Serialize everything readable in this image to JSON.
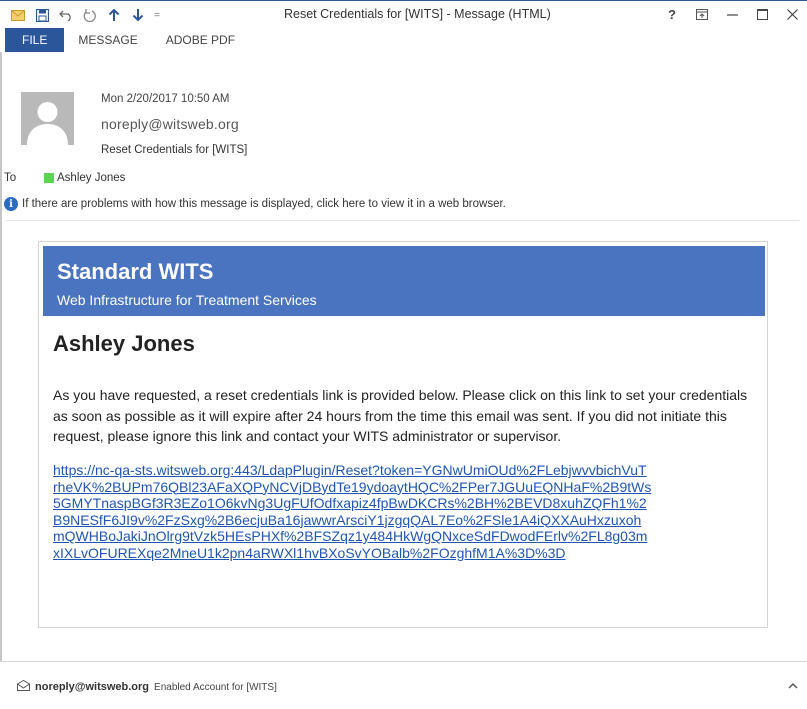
{
  "window": {
    "title": "Reset Credentials for [WITS] - Message (HTML)",
    "help_label": "?",
    "accent": "#2b579a"
  },
  "quick_access": {
    "icons": [
      "mail-icon",
      "save-icon",
      "undo-icon",
      "redo-icon",
      "previous-item-icon",
      "next-item-icon",
      "customize-icon"
    ],
    "sep_label": "="
  },
  "ribbon": {
    "tabs": [
      "FILE",
      "MESSAGE",
      "ADOBE PDF"
    ]
  },
  "header": {
    "sent_date": "Mon 2/20/2017 10:50 AM",
    "sender": "noreply@witsweb.org",
    "subject": "Reset Credentials for [WITS]",
    "to_label": "To",
    "recipient": "Ashley Jones",
    "info_message": "If there are problems with how this message is displayed, click here to view it in a web browser."
  },
  "email_body": {
    "banner_title": "Standard WITS",
    "banner_subtitle": "Web Infrastructure for Treatment Services",
    "banner_color": "#4a74bf",
    "recipient_name": "Ashley Jones",
    "paragraph": "As you have requested, a reset credentials link is provided below. Please click on this link to set your credentials as soon as possible as it will expire after 24 hours from the time this email was sent. If you did not initiate this request, please ignore this link and contact your WITS administrator or supervisor.",
    "link_lines": [
      "https://nc-qa-sts.witsweb.org:443/LdapPlugin/Reset?token=YGNwUmiOUd%2FLebjwvvbichVuT",
      "rheVK%2BUPm76QBl23AFaXQPyNCVjDBydTe19ydoaytHQC%2FPer7JGUuEQNHaF%2B9tWs",
      "5GMYTnaspBGf3R3EZo1O6kvNg3UgFUfOdfxapiz4fpBwDKCRs%2BH%2BEVD8xuhZQFh1%2",
      "B9NESfF6JI9v%2FzSxg%2B6ecjuBa16jawwrArsciY1jzgqQAL7Eo%2FSle1A4iQXXAuHxzuxoh",
      "mQWHBoJakiJnOlrg9tVzk5HEsPHXf%2BFSZqz1y484HkWgQNxceSdFDwodFErlv%2FL8g03m",
      "xIXLvOFUREXqe2MneU1k2pn4aRWXl1hvBXoSvYOBalb%2FOzghfM1A%3D%3D"
    ]
  },
  "footer": {
    "sender": "noreply@witsweb.org",
    "subject": "Enabled Account for [WITS]"
  }
}
